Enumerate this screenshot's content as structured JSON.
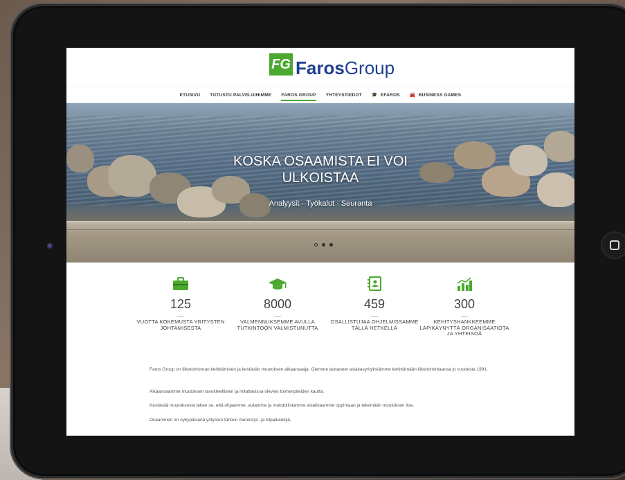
{
  "site": {
    "logo_mark": "FG",
    "logo_bold": "Faros",
    "logo_rest": "Group",
    "brand_green": "#4aa92e",
    "brand_blue": "#1f3f8f"
  },
  "nav": {
    "items": [
      {
        "label": "ETUSIVU"
      },
      {
        "label": "TUTUSTU PALVELUIHIMME"
      },
      {
        "label": "FAROS GROUP"
      },
      {
        "label": "YHTEYSTIEDOT"
      },
      {
        "label": "EFAROS",
        "icon": "graduation-cap-icon"
      },
      {
        "label": "BUSINESS GAMES",
        "icon": "car-icon"
      }
    ]
  },
  "hero": {
    "title": "KOSKA OSAAMISTA EI VOI ULKOISTAA",
    "subtitle": "Analyysit · Työkalut · Seuranta",
    "slide_count": 3,
    "active_slide": 1
  },
  "stats": [
    {
      "icon": "briefcase-icon",
      "value": "125",
      "label": "VUOTTA KOKEMUSTA YRITYSTEN JOHTAMISESTA"
    },
    {
      "icon": "graduation-cap-icon",
      "value": "8000",
      "label": "VALMENNUKSEMME AVULLA TUTKINTOON VALMISTUNUTTA"
    },
    {
      "icon": "contacts-book-icon",
      "value": "459",
      "label": "OSALLISTUJAA OHJELMISSAMME TÄLLÄ HETKELLÄ"
    },
    {
      "icon": "growth-chart-icon",
      "value": "300",
      "label": "KEHITYSHANKKEEMME LÄPIKÄYNYTTÄ ORGANISAATIOTA JA YHTEISÖÄ"
    }
  ],
  "paragraphs": [
    "Faros Group on liiketoiminnan kehittämisen ja kestävän muutoksen aikaansaaja. Olemme auttaneet asiakasyrityksiämme kehittämään liiketoimintaansa jo vuodesta 1991.",
    "Aikaansaamme muutoksen tavoitteellisten ja mitattavissa olevien toimenpiteiden kautta.",
    "Kestävää muutoksesta tekee se, että ohjaamme, autamme ja mahdollistamme asiakkaamme oppimaan ja tekemään muutoksen itse.",
    "Osaaminen on nykypäivänä yritysten tärkein menestys -ja kilpailutekijä."
  ]
}
